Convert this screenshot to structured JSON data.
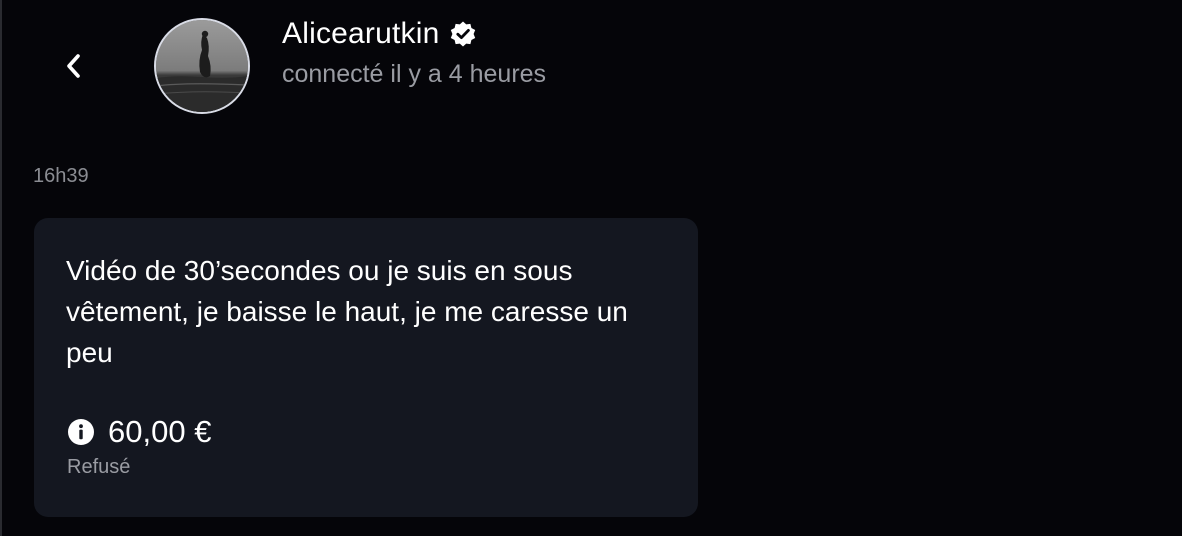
{
  "header": {
    "username": "Alicearutkin",
    "status": "connecté il y a 4 heures",
    "verified": true
  },
  "message": {
    "time": "16h39",
    "text": "Vidéo de 30’secondes ou je suis en sous vêtement, je baisse le haut, je me caresse un peu",
    "price": "60,00 €",
    "price_status": "Refusé"
  },
  "colors": {
    "background": "#050509",
    "bubble": "#141720",
    "muted_text": "#9a9ca3"
  },
  "icons": [
    "chevron-left-icon",
    "verified-badge-icon",
    "info-icon"
  ]
}
